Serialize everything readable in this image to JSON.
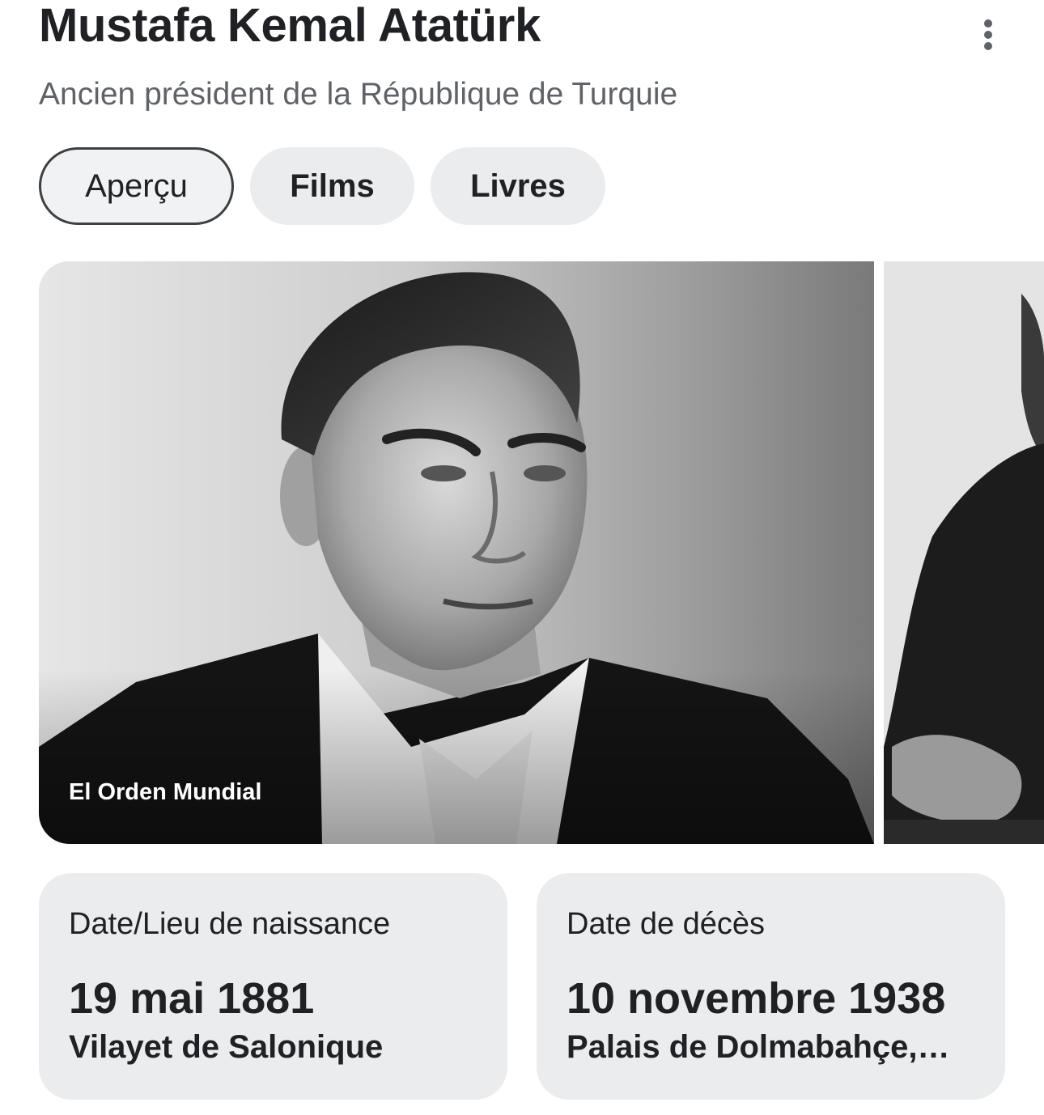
{
  "header": {
    "title": "Mustafa Kemal Atatürk",
    "subtitle": "Ancien président de la République de Turquie",
    "more_icon": "more-vertical-icon"
  },
  "tabs": [
    {
      "label": "Aperçu",
      "active": true
    },
    {
      "label": "Films",
      "active": false
    },
    {
      "label": "Livres",
      "active": false
    }
  ],
  "images": {
    "main": {
      "credit": "El Orden Mundial"
    }
  },
  "facts": [
    {
      "label": "Date/Lieu de naissance",
      "value": "19 mai 1881",
      "detail": "Vilayet de Salonique"
    },
    {
      "label": "Date de décès",
      "value": "10 novembre 1938",
      "detail": "Palais de Dolmabahçe,…"
    }
  ],
  "colors": {
    "text": "#202124",
    "muted": "#5f6368",
    "chip_bg": "#ebecee",
    "active_border": "#3c4043"
  }
}
